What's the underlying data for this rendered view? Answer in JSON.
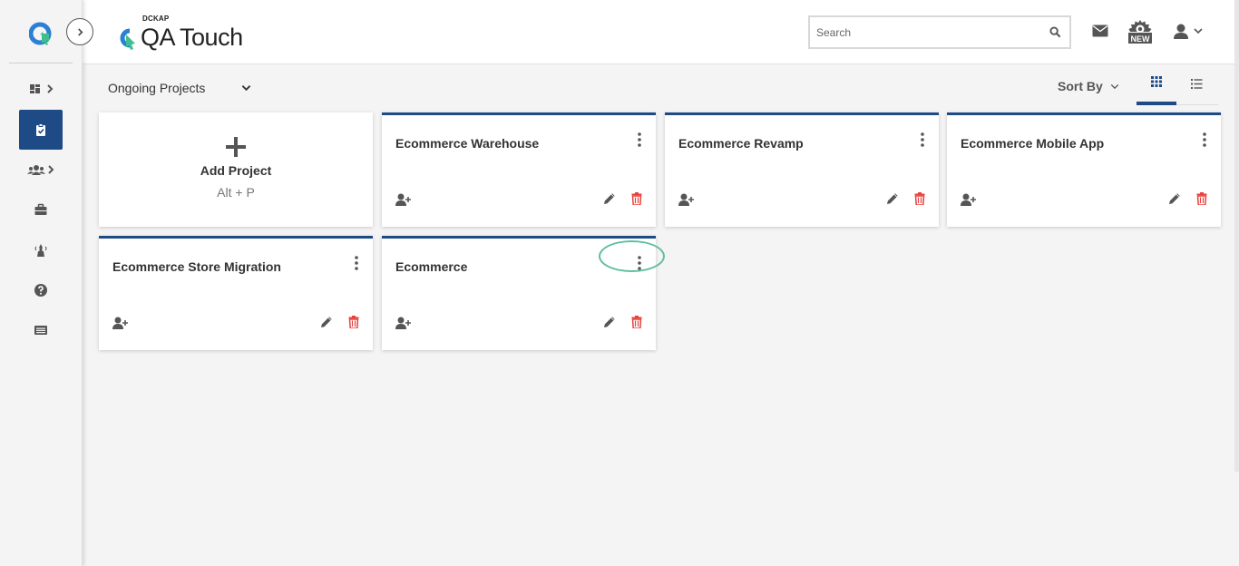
{
  "app": {
    "brand_small": "DCKAP",
    "brand_name": "QA Touch"
  },
  "header": {
    "search_placeholder": "Search",
    "icons": [
      "mail-icon",
      "new-feature-icon",
      "user-icon",
      "chevron-down-icon"
    ],
    "new_badge": "NEW"
  },
  "sidebar": {
    "items": [
      {
        "name": "dashboard",
        "icon": "dashboard-icon",
        "has_submenu": true
      },
      {
        "name": "projects",
        "icon": "clipboard-check-icon",
        "active": true
      },
      {
        "name": "users",
        "icon": "users-icon",
        "has_submenu": true
      },
      {
        "name": "workspace",
        "icon": "briefcase-icon"
      },
      {
        "name": "tools",
        "icon": "tower-icon"
      },
      {
        "name": "help",
        "icon": "question-icon"
      },
      {
        "name": "reports",
        "icon": "list-card-icon"
      }
    ]
  },
  "toolbar": {
    "filter_label": "Ongoing Projects",
    "sort_label": "Sort By"
  },
  "add_card": {
    "label": "Add Project",
    "hint": "Alt + P"
  },
  "projects": [
    {
      "title": "Ecommerce Warehouse"
    },
    {
      "title": "Ecommerce Revamp"
    },
    {
      "title": "Ecommerce Mobile App"
    },
    {
      "title": "Ecommerce Store Migration"
    },
    {
      "title": "Ecommerce"
    }
  ],
  "colors": {
    "accent": "#1e4a86",
    "danger": "#e8413c",
    "highlight": "#5fbfa0",
    "brand_blue": "#2b7fd4",
    "brand_green": "#3fbf8f"
  }
}
